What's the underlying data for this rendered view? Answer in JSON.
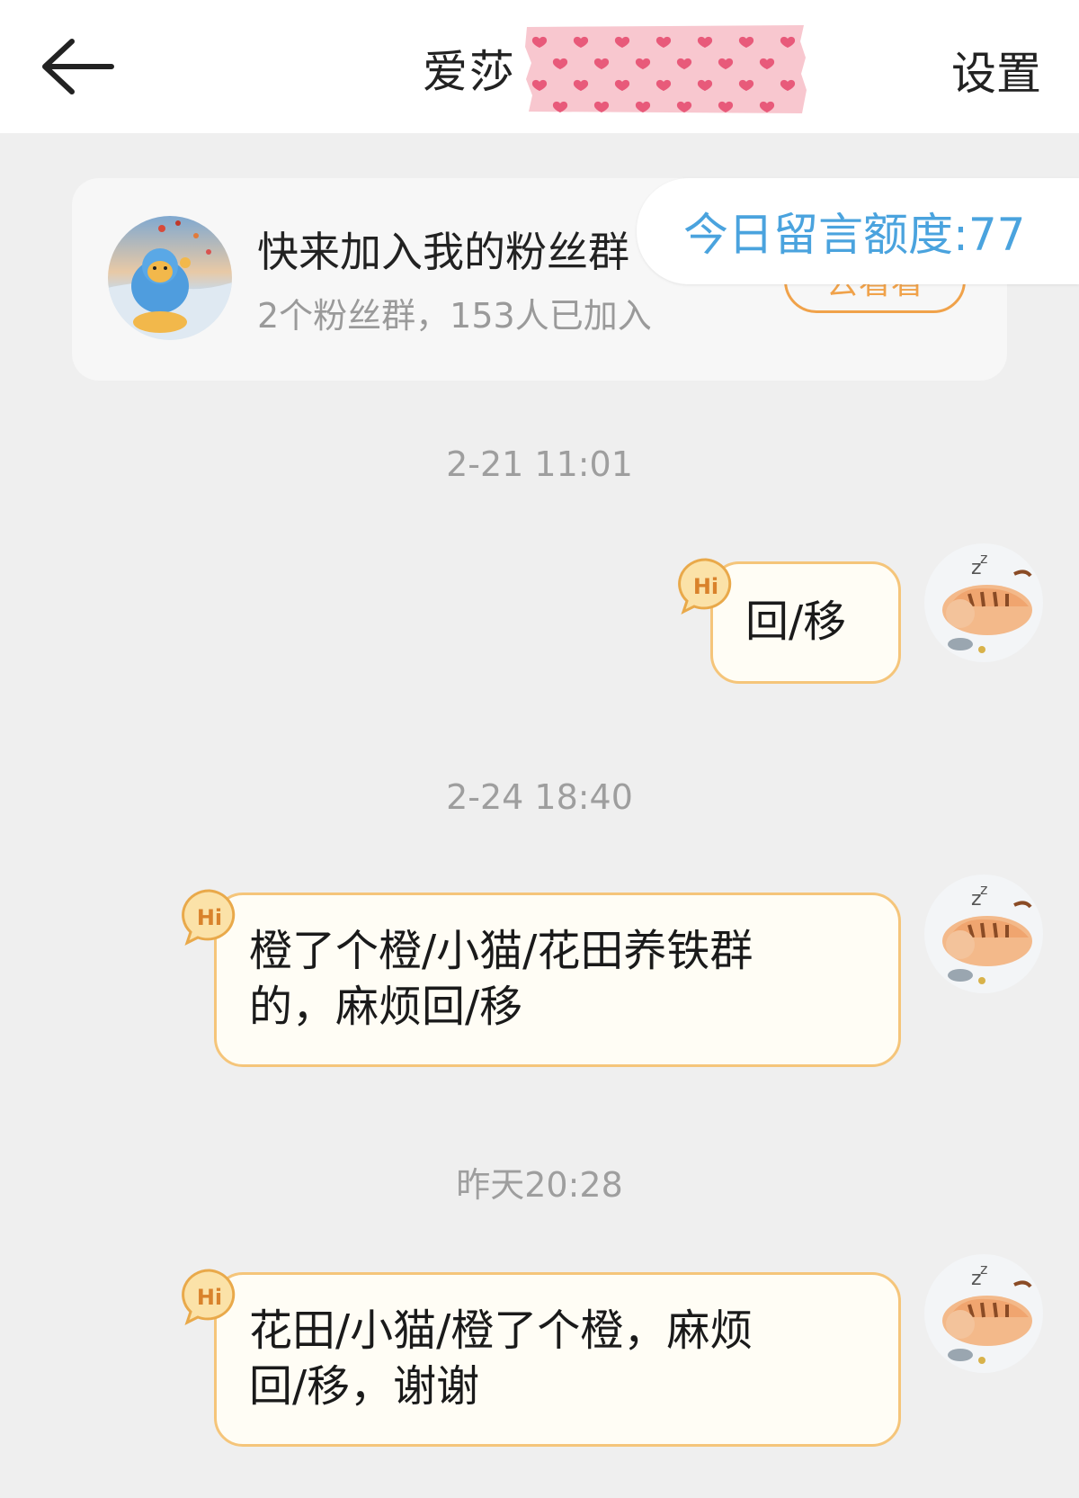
{
  "header": {
    "title": "爱莎",
    "settings_label": "设置"
  },
  "fan_card": {
    "title": "快来加入我的粉丝群",
    "subtitle": "2个粉丝群，153人已加入",
    "join_button": "去看看"
  },
  "quota": {
    "label": "今日留言额度:77"
  },
  "messages": [
    {
      "timestamp": "2-21 11:01",
      "lines": [
        "回/移"
      ],
      "badge": "Hi"
    },
    {
      "timestamp": "2-24 18:40",
      "lines": [
        "橙了个橙/小猫/花田养铁群",
        "的，麻烦回/移"
      ],
      "badge": "Hi"
    },
    {
      "timestamp": "昨天20:28",
      "lines": [
        "花田/小猫/橙了个橙，麻烦",
        "回/移，谢谢"
      ],
      "badge": "Hi"
    }
  ],
  "colors": {
    "bubble_border": "#f5c57a",
    "bubble_fill": "#fffdf5",
    "quota_text": "#4aa3de",
    "join_button": "#f0a24a",
    "masking_tape": "#f8c7cf",
    "heart": "#e85a7a"
  },
  "icons": {
    "back": "arrow-left-icon",
    "hi": "hi-speech-badge-icon",
    "tape": "heart-masking-tape"
  }
}
